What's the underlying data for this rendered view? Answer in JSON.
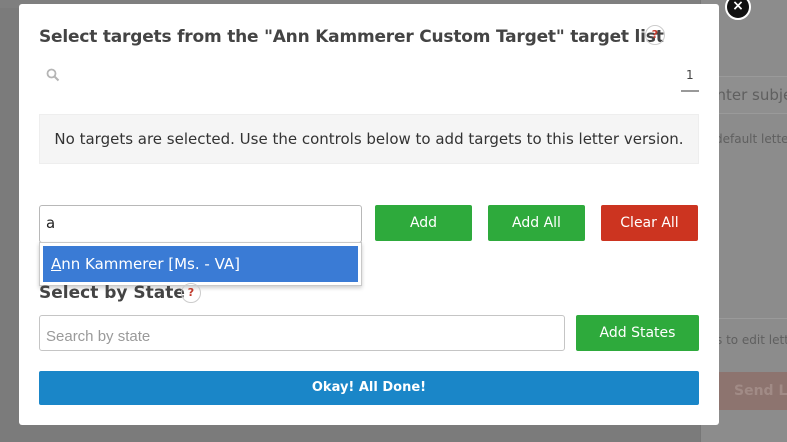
{
  "background": {
    "subject_placeholder": "Enter subject",
    "default_letter_text": "default letter",
    "edit_letter_text": "s to edit letter",
    "send_button_label": "Send Letter"
  },
  "modal": {
    "title": "Select targets from the \"Ann Kammerer Custom Target\" target list",
    "help_label": "?",
    "page_number": "1",
    "notice_text": "No targets are selected. Use the controls below to add targets to this letter version.",
    "target_input_value": "a",
    "dropdown": {
      "match_prefix": "A",
      "match_rest": "nn Kammerer [Ms. - VA]"
    },
    "add_label": "Add",
    "add_all_label": "Add All",
    "clear_all_label": "Clear All",
    "state_section_title": "Select by State",
    "state_search_placeholder": "Search by state",
    "add_states_label": "Add States",
    "done_label": "Okay! All Done!",
    "close_label": "×"
  },
  "colors": {
    "green": "#2eaa3c",
    "red": "#cc3420",
    "blue_button": "#1a86c8",
    "dropdown_highlight": "#3a7bd5",
    "help_mark": "#c0392b"
  },
  "icons": {
    "search": "search-icon",
    "close": "close-icon",
    "help": "help-icon"
  }
}
